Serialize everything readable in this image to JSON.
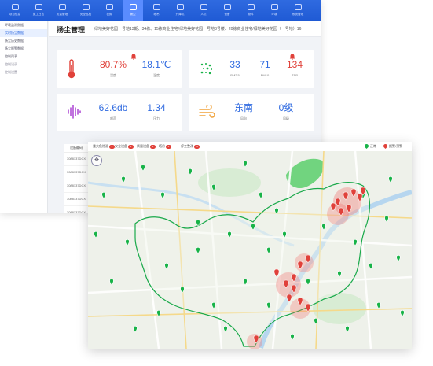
{
  "nav": [
    {
      "label": "项目信息",
      "active": false
    },
    {
      "label": "施工日志",
      "active": false
    },
    {
      "label": "质量管理",
      "active": false
    },
    {
      "label": "安全巡检",
      "active": false
    },
    {
      "label": "视频",
      "active": false
    },
    {
      "label": "扬尘",
      "active": true
    },
    {
      "label": "塔吊",
      "active": false
    },
    {
      "label": "升降机",
      "active": false
    },
    {
      "label": "人员",
      "active": false
    },
    {
      "label": "设备",
      "active": false
    },
    {
      "label": "物料",
      "active": false
    },
    {
      "label": "环境",
      "active": false
    },
    {
      "label": "系统管理",
      "active": false
    }
  ],
  "sidebar": [
    {
      "label": "环境监测数据",
      "state": "normal"
    },
    {
      "label": "实时扬尘数据",
      "state": "selected"
    },
    {
      "label": "扬尘历史数据",
      "state": "normal"
    },
    {
      "label": "扬尘报警数据",
      "state": "normal"
    },
    {
      "label": "控制列表",
      "state": "normal"
    },
    {
      "label": "控制记录",
      "state": "muted"
    },
    {
      "label": "控制设置",
      "state": "muted"
    }
  ],
  "page": {
    "title": "扬尘管理",
    "desc": "绿地美好花园一号地13期、34栋、15栋商业住宅/绿地美好花园一号地3号楼、20栋商业住宅/绿地美好花园（一号地）16"
  },
  "metrics": {
    "humidity": {
      "value": "80.7%",
      "label": "湿度"
    },
    "temperature": {
      "value": "18.1℃",
      "label": "温度"
    },
    "pm25": {
      "value": "33",
      "label": "PM2.5"
    },
    "pm10": {
      "value": "71",
      "label": "PM10"
    },
    "tsp": {
      "value": "134",
      "label": "TSP"
    },
    "noise": {
      "value": "62.6db",
      "label": "噪声"
    },
    "pressure": {
      "value": "1.34",
      "label": "压力"
    },
    "wind_dir": {
      "value": "东南",
      "label": "风向"
    },
    "wind_level": {
      "value": "0级",
      "label": "风级"
    }
  },
  "table": {
    "header": "设备编码",
    "rows": [
      "3088137DCX",
      "3088137DCX",
      "3088137DCX",
      "3088137DCX",
      "3088137DCX"
    ]
  },
  "mapbar": {
    "filters": [
      {
        "label": "重大危险源",
        "count": "2"
      },
      {
        "label": "安全设备",
        "count": "3"
      },
      {
        "label": "质量设备",
        "count": "1"
      },
      {
        "label": "塔吊",
        "count": "4"
      },
      {
        "label": "停工整改",
        "count": "26"
      }
    ],
    "legend": [
      {
        "label": "正常",
        "color": "#18b348"
      },
      {
        "label": "报警/预警",
        "color": "#e0413a"
      }
    ]
  },
  "colors": {
    "primary": "#2f6ae0",
    "alert": "#e0413a",
    "ok": "#18b348",
    "map_bg": "#eef1ea"
  }
}
